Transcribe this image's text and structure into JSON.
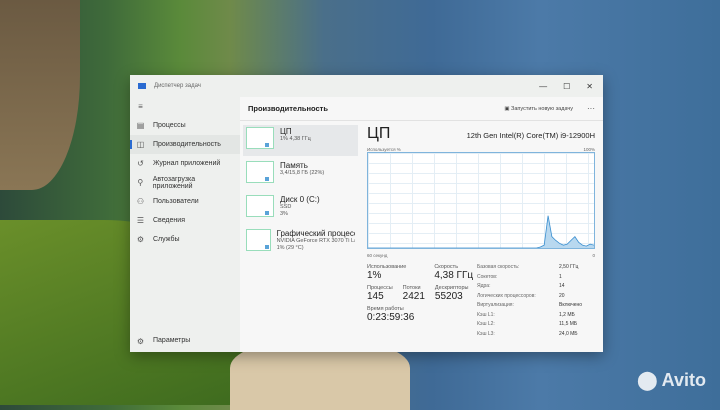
{
  "window": {
    "title": "Диспетчер задач",
    "controls": [
      "—",
      "☐",
      "✕"
    ]
  },
  "sidebar": {
    "items": [
      {
        "label": "Процессы",
        "icon": "processes-icon",
        "glyph": "▤"
      },
      {
        "label": "Производительность",
        "icon": "performance-icon",
        "glyph": "◫",
        "active": true
      },
      {
        "label": "Журнал приложений",
        "icon": "history-icon",
        "glyph": "↺"
      },
      {
        "label": "Автозагрузка приложений",
        "icon": "startup-icon",
        "glyph": "⚲"
      },
      {
        "label": "Пользователи",
        "icon": "users-icon",
        "glyph": "⚇"
      },
      {
        "label": "Сведения",
        "icon": "details-icon",
        "glyph": "☰"
      },
      {
        "label": "Службы",
        "icon": "services-icon",
        "glyph": "⚙"
      }
    ],
    "settings": "Параметры"
  },
  "header": {
    "title": "Производительность",
    "run_task": "Запустить новую задачу",
    "more": "···"
  },
  "devices": [
    {
      "title": "ЦП",
      "sub1": "1% 4,38 ГГц",
      "sub2": ""
    },
    {
      "title": "Память",
      "sub1": "3,4/15,8 ГБ (22%)",
      "sub2": ""
    },
    {
      "title": "Диск 0 (C:)",
      "sub1": "SSD",
      "sub2": "3%"
    },
    {
      "title": "Графический процессор",
      "sub1": "NVIDIA GeForce RTX 3070 Ti La",
      "sub2": "1% (29 °C)"
    }
  ],
  "cpu": {
    "title": "ЦП",
    "model": "12th Gen Intel(R) Core(TM) i9-12900H",
    "usage_label": "Используется %",
    "max_label": "100%",
    "time_label": "60 секунд",
    "min_label": "0",
    "graph_values": [
      0,
      0,
      0,
      0,
      0,
      0,
      0,
      0,
      0,
      0,
      0,
      0,
      0,
      0,
      0,
      0,
      0,
      0,
      0,
      0,
      0,
      0,
      0,
      0,
      0,
      0,
      0,
      0,
      0,
      0,
      0,
      0,
      0,
      0,
      0,
      0,
      0,
      0,
      0,
      0,
      0,
      0,
      0,
      0,
      0,
      1,
      3,
      34,
      12,
      8,
      5,
      3,
      4,
      8,
      12,
      6,
      3,
      2,
      4,
      3
    ],
    "stats": {
      "usage_k": "Использование",
      "usage_v": "1%",
      "speed_k": "Скорость",
      "speed_v": "4,38 ГГц",
      "proc_k": "Процессы",
      "proc_v": "145",
      "threads_k": "Потоки",
      "threads_v": "2421",
      "handles_k": "Дескрипторы",
      "handles_v": "55203",
      "uptime_k": "Время работы",
      "uptime_v": "0:23:59:36"
    },
    "specs": [
      [
        "Базовая скорость:",
        "2,50 ГГц"
      ],
      [
        "Сокетов:",
        "1"
      ],
      [
        "Ядра:",
        "14"
      ],
      [
        "Логических процессоров:",
        "20"
      ],
      [
        "Виртуализация:",
        "Включено"
      ],
      [
        "Кэш L1:",
        "1,2 МБ"
      ],
      [
        "Кэш L2:",
        "11,5 МБ"
      ],
      [
        "Кэш L3:",
        "24,0 МБ"
      ]
    ]
  },
  "watermark": "Avito"
}
